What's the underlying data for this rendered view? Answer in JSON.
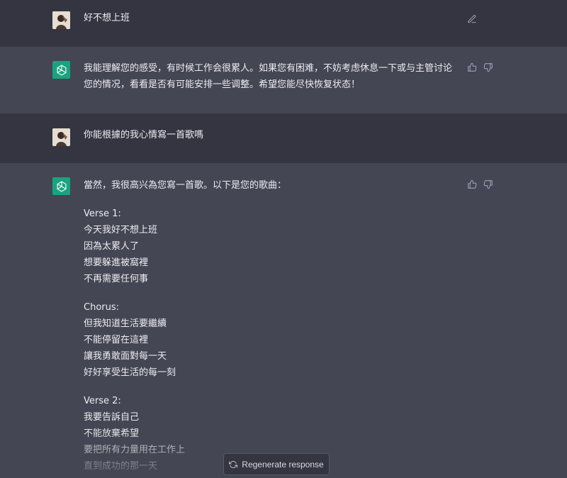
{
  "messages": [
    {
      "role": "user",
      "avatar_icon": "user-photo-avatar",
      "text": "好不想上班",
      "actions": [
        "edit-icon"
      ]
    },
    {
      "role": "assistant",
      "avatar_icon": "openai-logo-icon",
      "paragraphs": [
        "我能理解您的感受，有时候工作会很累人。如果您有困难，不妨考虑休息一下或与主管讨论您的情况，看看是否有可能安排一些调整。希望您能尽快恢复状态！"
      ],
      "actions": [
        "thumbs-up-icon",
        "thumbs-down-icon"
      ]
    },
    {
      "role": "user",
      "avatar_icon": "user-photo-avatar",
      "text": "你能根據的我心情寫一首歌嗎"
    },
    {
      "role": "assistant",
      "avatar_icon": "openai-logo-icon",
      "intro": "當然，我很高兴為您寫一首歌。以下是您的歌曲：",
      "stanzas": [
        {
          "heading": "Verse 1:",
          "lines": [
            "今天我好不想上班",
            "因為太累人了",
            "想要躲進被窩裡",
            "不再需要任何事"
          ]
        },
        {
          "heading": "Chorus:",
          "lines": [
            "但我知道生活要繼續",
            "不能停留在這裡",
            "讓我勇敢面對每一天",
            "好好享受生活的每一刻"
          ]
        },
        {
          "heading": "Verse 2:",
          "lines": [
            "我要告訴自己",
            "不能放棄希望",
            "要把所有力量用在工作上",
            "直到成功的那一天"
          ]
        }
      ],
      "actions": [
        "thumbs-up-icon",
        "thumbs-down-icon"
      ]
    }
  ],
  "regenerate_button": {
    "label": "Regenerate response",
    "icon": "refresh-icon"
  },
  "colors": {
    "user_bg": "#343541",
    "assistant_bg": "#444654",
    "openai_green": "#19a47f",
    "text": "#ececf1"
  }
}
